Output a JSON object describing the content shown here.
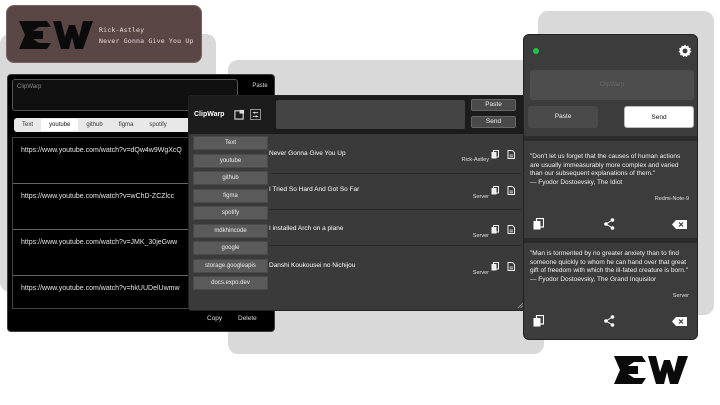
{
  "header": {
    "artist": "Rick-Astley",
    "song": "Never Gonna Give You Up"
  },
  "left_window": {
    "input_placeholder": "ClipWarp",
    "paste_label": "Paste",
    "tabs": [
      "Text",
      "youtube",
      "github",
      "figma",
      "spotify"
    ],
    "active_tab": "youtube",
    "urls": [
      "https://www.youtube.com/watch?v=dQw4w9WgXcQ",
      "https://www.youtube.com/watch?v=wChD-ZCZlcc",
      "https://www.youtube.com/watch?v=JMK_30jeGww",
      "https://www.youtube.com/watch?v=hkUUDelUwmw"
    ],
    "copy_label": "Copy",
    "delete_label": "Delete"
  },
  "middle_window": {
    "title": "ClipWarp",
    "paste_label": "Paste",
    "send_label": "Send",
    "sidebar": [
      "Text",
      "youtube",
      "github",
      "figma",
      "spotify",
      "mdkhincode",
      "google",
      "storage.googleapis",
      "docs.expo.dev"
    ],
    "items": [
      {
        "title": "Never Gonna Give You Up",
        "source": "Rick-Astley"
      },
      {
        "title": "I Tried So Hard And Got So Far",
        "source": "Server"
      },
      {
        "title": "I installed Arch on a plane",
        "source": "Server"
      },
      {
        "title": "Danshi Koukousei no Nichijou",
        "source": "Server"
      }
    ]
  },
  "phone": {
    "input_placeholder": "ClipWarp",
    "paste_label": "Paste",
    "send_label": "Send",
    "quotes": [
      {
        "text": "\"Don't let us forget that the causes of human actions are usually immeasurably more complex and varied than our subsequent explanations of them.\"",
        "author": "— Fyodor Dostoevsky, The Idiot",
        "source": "Redmi-Note-9"
      },
      {
        "text": "\"Man is tormented by no greater anxiety than to find someone quickly to whom he can hand over that great gift of freedom with which the ill-fated creature is born.\"",
        "author": "— Fyodor Dostoevsky, The Grand Inquisitor",
        "source": "Server"
      }
    ],
    "status_color": "#21c448"
  },
  "icons": [
    "cw-logo",
    "gear-icon",
    "copy-icon",
    "document-icon",
    "share-icon",
    "backspace-icon",
    "new-window-icon",
    "settings-sliders-icon"
  ]
}
